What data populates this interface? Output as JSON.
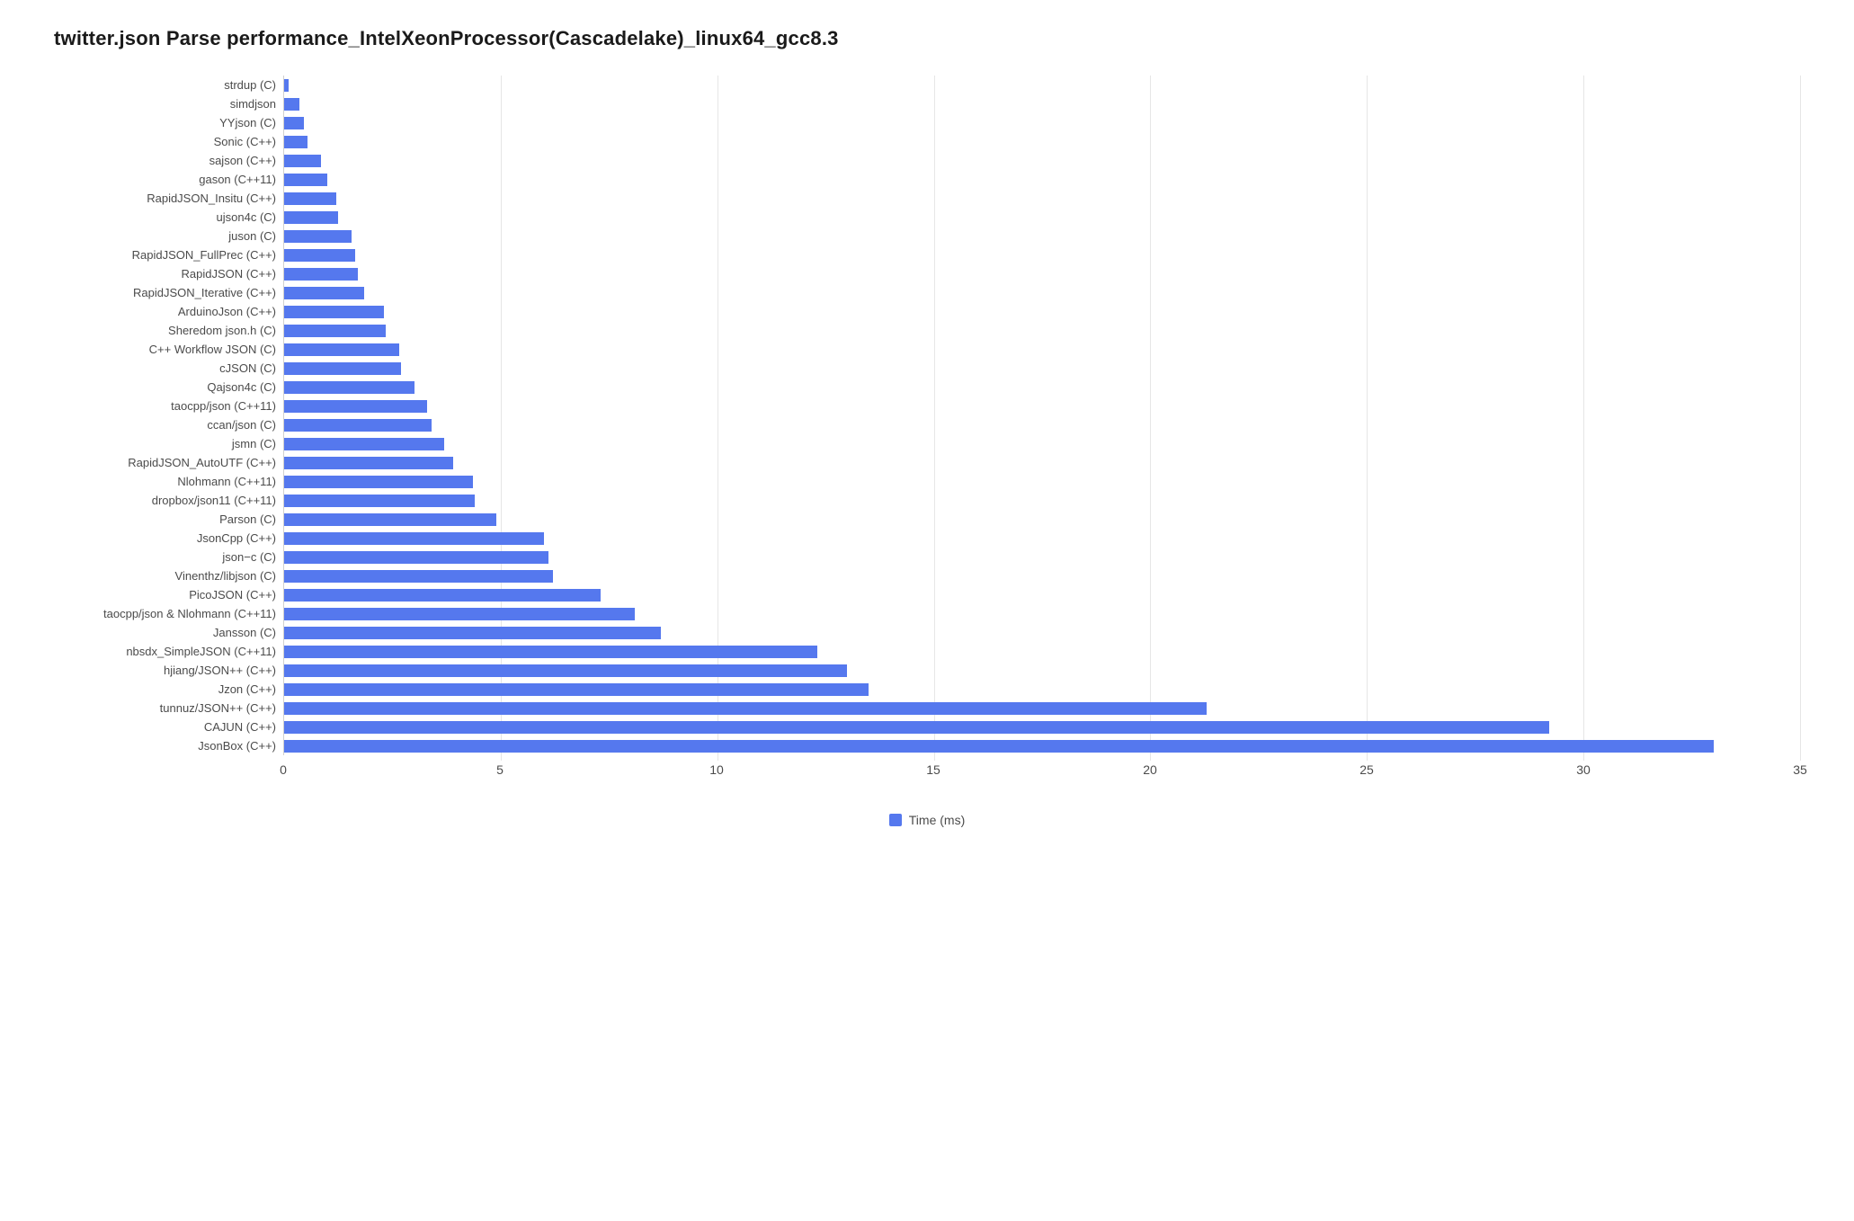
{
  "title": "twitter.json Parse performance_IntelXeonProcessor(Cascadelake)_linux64_gcc8.3",
  "legend": {
    "label": "Time (ms)",
    "color": "#5578ee"
  },
  "chart_data": {
    "type": "bar",
    "orientation": "horizontal",
    "title": "twitter.json Parse performance_IntelXeonProcessor(Cascadelake)_linux64_gcc8.3",
    "xlabel": "",
    "ylabel": "",
    "xlim": [
      0,
      35
    ],
    "xticks": [
      0,
      5,
      10,
      15,
      20,
      25,
      30,
      35
    ],
    "categories": [
      "strdup (C)",
      "simdjson",
      "YYjson (C)",
      "Sonic (C++)",
      "sajson (C++)",
      "gason (C++11)",
      "RapidJSON_Insitu (C++)",
      "ujson4c (C)",
      "juson (C)",
      "RapidJSON_FullPrec (C++)",
      "RapidJSON (C++)",
      "RapidJSON_Iterative (C++)",
      "ArduinoJson (C++)",
      "Sheredom json.h (C)",
      "C++ Workflow JSON (C)",
      "cJSON (C)",
      "Qajson4c (C)",
      "taocpp/json (C++11)",
      "ccan/json (C)",
      "jsmn (C)",
      "RapidJSON_AutoUTF (C++)",
      "Nlohmann (C++11)",
      "dropbox/json11 (C++11)",
      "Parson (C)",
      "JsonCpp (C++)",
      "json−c (C)",
      "Vinenthz/libjson (C)",
      "PicoJSON (C++)",
      "taocpp/json & Nlohmann (C++11)",
      "Jansson (C)",
      "nbsdx_SimpleJSON (C++11)",
      "hjiang/JSON++ (C++)",
      "Jzon (C++)",
      "tunnuz/JSON++ (C++)",
      "CAJUN (C++)",
      "JsonBox (C++)"
    ],
    "values": [
      0.1,
      0.35,
      0.45,
      0.55,
      0.85,
      1.0,
      1.2,
      1.25,
      1.55,
      1.65,
      1.7,
      1.85,
      2.3,
      2.35,
      2.65,
      2.7,
      3.0,
      3.3,
      3.4,
      3.7,
      3.9,
      4.35,
      4.4,
      4.9,
      6.0,
      6.1,
      6.2,
      7.3,
      8.1,
      8.7,
      12.3,
      13.0,
      13.5,
      21.3,
      29.2,
      33.0
    ],
    "series": [
      {
        "name": "Time (ms)",
        "color": "#5578ee"
      }
    ],
    "legend_position": "bottom",
    "grid": {
      "x": true,
      "y": false
    }
  }
}
